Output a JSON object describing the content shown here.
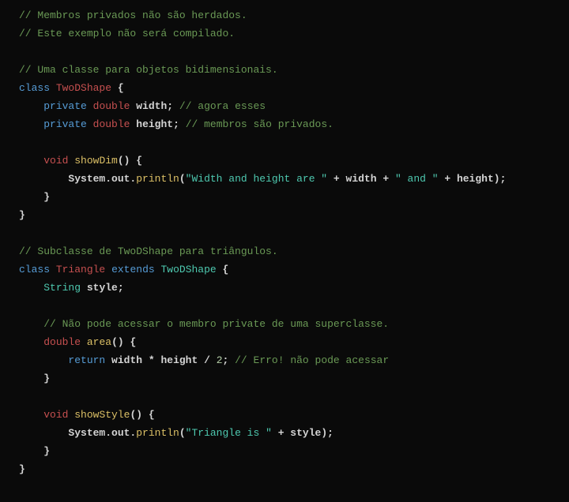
{
  "code": {
    "c1": "// Membros privados não são herdados.",
    "c2": "// Este exemplo não será compilado.",
    "c3": "// Uma classe para objetos bidimensionais.",
    "kw_class1": "class",
    "cls_TwoDShape1": "TwoDShape",
    "brace_o1": " {",
    "kw_private1": "private",
    "kw_double1": "double",
    "id_width1": "width",
    "semi1": ";",
    "c4": " // agora esses",
    "kw_private2": "private",
    "kw_double2": "double",
    "id_height1": "height",
    "semi2": ";",
    "c5": " // membros são privados.",
    "kw_void1": "void",
    "m_showDim": "showDim",
    "paren1": "() {",
    "sys1_a": "System.out.",
    "sys1_b": "println",
    "sys1_c": "(",
    "str1": "\"Width and height are \"",
    "op1": " + ",
    "id_width2": "width",
    "op2": " + ",
    "str2": "\" and \"",
    "op3": " + ",
    "id_height2": "height",
    "sys1_d": ");",
    "brace_c1": "}",
    "brace_c2": "}",
    "c6": "// Subclasse de TwoDShape para triângulos.",
    "kw_class2": "class",
    "cls_Triangle": "Triangle",
    "kw_extends": "extends",
    "cls_TwoDShape2": "TwoDShape",
    "brace_o2": " {",
    "type_String": "String",
    "id_style1": "style",
    "semi3": ";",
    "c7": "// Não pode acessar o membro private de uma superclasse.",
    "kw_double3": "double",
    "m_area": "area",
    "paren2": "() {",
    "kw_return": "return",
    "id_width3": "width",
    "op4": " * ",
    "id_height3": "height",
    "op5": " / ",
    "num_2": "2",
    "semi4": ";",
    "c8": " // Erro! não pode acessar",
    "brace_c3": "}",
    "kw_void2": "void",
    "m_showStyle": "showStyle",
    "paren3": "() {",
    "sys2_a": "System.out.",
    "sys2_b": "println",
    "sys2_c": "(",
    "str3": "\"Triangle is \"",
    "op6": " + ",
    "id_style2": "style",
    "sys2_d": ");",
    "brace_c4": "}",
    "brace_c5": "}"
  }
}
